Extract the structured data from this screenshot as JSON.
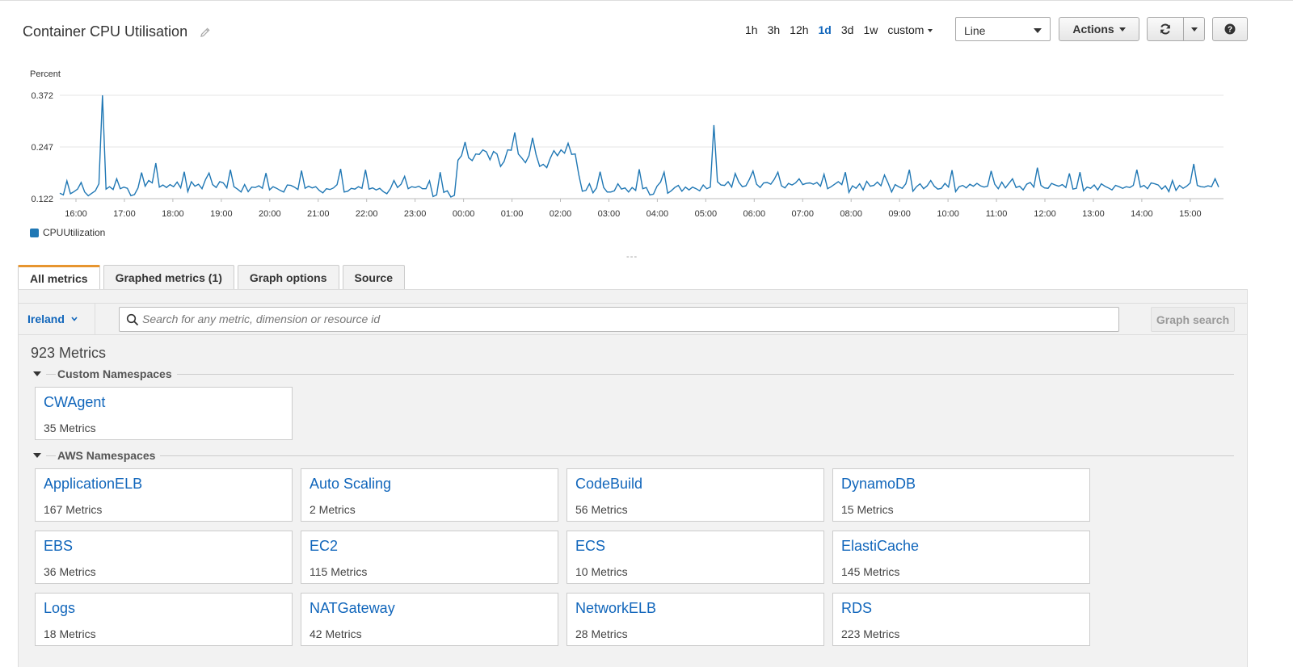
{
  "header": {
    "title": "Container CPU Utilisation",
    "time_ranges": [
      "1h",
      "3h",
      "12h",
      "1d",
      "3d",
      "1w"
    ],
    "active_range": "1d",
    "custom_label": "custom",
    "view_type": "Line",
    "actions_label": "Actions",
    "help_label": "?"
  },
  "chart": {
    "unit_label": "Percent",
    "y_ticks": [
      "0.372",
      "0.247",
      "0.122"
    ],
    "x_ticks": [
      "16:00",
      "17:00",
      "18:00",
      "19:00",
      "20:00",
      "21:00",
      "22:00",
      "23:00",
      "00:00",
      "01:00",
      "02:00",
      "03:00",
      "04:00",
      "05:00",
      "06:00",
      "07:00",
      "08:00",
      "09:00",
      "10:00",
      "11:00",
      "12:00",
      "13:00",
      "14:00",
      "15:00"
    ],
    "legend": "CPUUtilization",
    "color": "#1f77b4"
  },
  "chart_data": {
    "type": "line",
    "ylabel": "Percent",
    "ylim": [
      0.122,
      0.372
    ],
    "x_start": "15:40",
    "x_end": "15:35",
    "series": [
      {
        "name": "CPUUtilization",
        "values": [
          0.135,
          0.131,
          0.165,
          0.134,
          0.139,
          0.145,
          0.161,
          0.138,
          0.129,
          0.135,
          0.141,
          0.158,
          0.372,
          0.145,
          0.151,
          0.144,
          0.17,
          0.146,
          0.15,
          0.147,
          0.129,
          0.132,
          0.148,
          0.185,
          0.152,
          0.166,
          0.16,
          0.208,
          0.15,
          0.155,
          0.149,
          0.156,
          0.151,
          0.162,
          0.148,
          0.187,
          0.139,
          0.163,
          0.152,
          0.157,
          0.146,
          0.168,
          0.184,
          0.156,
          0.149,
          0.163,
          0.16,
          0.148,
          0.192,
          0.151,
          0.145,
          0.138,
          0.156,
          0.139,
          0.15,
          0.149,
          0.153,
          0.147,
          0.184,
          0.143,
          0.151,
          0.147,
          0.142,
          0.138,
          0.155,
          0.154,
          0.15,
          0.144,
          0.19,
          0.147,
          0.152,
          0.148,
          0.151,
          0.142,
          0.136,
          0.146,
          0.144,
          0.148,
          0.156,
          0.194,
          0.138,
          0.14,
          0.147,
          0.145,
          0.151,
          0.147,
          0.192,
          0.145,
          0.148,
          0.143,
          0.147,
          0.139,
          0.134,
          0.146,
          0.166,
          0.149,
          0.157,
          0.176,
          0.146,
          0.151,
          0.149,
          0.152,
          0.146,
          0.146,
          0.165,
          0.127,
          0.131,
          0.186,
          0.137,
          0.141,
          0.126,
          0.13,
          0.215,
          0.226,
          0.259,
          0.221,
          0.214,
          0.23,
          0.229,
          0.24,
          0.235,
          0.216,
          0.236,
          0.23,
          0.2,
          0.212,
          0.24,
          0.239,
          0.282,
          0.23,
          0.22,
          0.209,
          0.226,
          0.269,
          0.228,
          0.2,
          0.205,
          0.197,
          0.22,
          0.238,
          0.226,
          0.24,
          0.232,
          0.256,
          0.229,
          0.23,
          0.18,
          0.14,
          0.142,
          0.158,
          0.136,
          0.148,
          0.187,
          0.149,
          0.138,
          0.138,
          0.141,
          0.158,
          0.145,
          0.148,
          0.138,
          0.149,
          0.142,
          0.193,
          0.146,
          0.149,
          0.131,
          0.133,
          0.152,
          0.162,
          0.186,
          0.135,
          0.141,
          0.149,
          0.154,
          0.14,
          0.15,
          0.143,
          0.15,
          0.146,
          0.141,
          0.155,
          0.146,
          0.15,
          0.3,
          0.163,
          0.155,
          0.154,
          0.163,
          0.15,
          0.183,
          0.162,
          0.151,
          0.153,
          0.169,
          0.189,
          0.157,
          0.149,
          0.16,
          0.161,
          0.157,
          0.169,
          0.186,
          0.153,
          0.148,
          0.159,
          0.155,
          0.16,
          0.17,
          0.156,
          0.159,
          0.16,
          0.157,
          0.161,
          0.152,
          0.181,
          0.146,
          0.151,
          0.157,
          0.163,
          0.156,
          0.186,
          0.137,
          0.153,
          0.147,
          0.158,
          0.143,
          0.164,
          0.152,
          0.154,
          0.162,
          0.153,
          0.179,
          0.16,
          0.138,
          0.156,
          0.151,
          0.147,
          0.158,
          0.192,
          0.14,
          0.151,
          0.158,
          0.146,
          0.153,
          0.166,
          0.152,
          0.145,
          0.147,
          0.159,
          0.15,
          0.191,
          0.139,
          0.151,
          0.154,
          0.148,
          0.157,
          0.152,
          0.159,
          0.153,
          0.15,
          0.152,
          0.189,
          0.157,
          0.146,
          0.162,
          0.148,
          0.159,
          0.17,
          0.149,
          0.152,
          0.143,
          0.157,
          0.161,
          0.15,
          0.197,
          0.154,
          0.148,
          0.147,
          0.159,
          0.155,
          0.152,
          0.156,
          0.149,
          0.183,
          0.145,
          0.147,
          0.186,
          0.141,
          0.15,
          0.147,
          0.155,
          0.143,
          0.158,
          0.152,
          0.148,
          0.143,
          0.154,
          0.151,
          0.147,
          0.151,
          0.149,
          0.154,
          0.192,
          0.15,
          0.154,
          0.146,
          0.16,
          0.158,
          0.155,
          0.145,
          0.153,
          0.139,
          0.166,
          0.142,
          0.154,
          0.147,
          0.152,
          0.16,
          0.206,
          0.154,
          0.151,
          0.15,
          0.153,
          0.151,
          0.17,
          0.15
        ]
      }
    ]
  },
  "tabs": [
    {
      "label": "All metrics",
      "active": true
    },
    {
      "label": "Graphed metrics (1)",
      "active": false
    },
    {
      "label": "Graph options",
      "active": false
    },
    {
      "label": "Source",
      "active": false
    }
  ],
  "search": {
    "region": "Ireland",
    "placeholder": "Search for any metric, dimension or resource id",
    "value": "",
    "graph_search_label": "Graph search"
  },
  "metrics_count": "923 Metrics",
  "custom_namespaces": {
    "label": "Custom Namespaces",
    "items": [
      {
        "name": "CWAgent",
        "count": "35 Metrics"
      }
    ]
  },
  "aws_namespaces": {
    "label": "AWS Namespaces",
    "items": [
      {
        "name": "ApplicationELB",
        "count": "167 Metrics"
      },
      {
        "name": "Auto Scaling",
        "count": "2 Metrics"
      },
      {
        "name": "CodeBuild",
        "count": "56 Metrics"
      },
      {
        "name": "DynamoDB",
        "count": "15 Metrics"
      },
      {
        "name": "EBS",
        "count": "36 Metrics"
      },
      {
        "name": "EC2",
        "count": "115 Metrics"
      },
      {
        "name": "ECS",
        "count": "10 Metrics"
      },
      {
        "name": "ElastiCache",
        "count": "145 Metrics"
      },
      {
        "name": "Logs",
        "count": "18 Metrics"
      },
      {
        "name": "NATGateway",
        "count": "42 Metrics"
      },
      {
        "name": "NetworkELB",
        "count": "28 Metrics"
      },
      {
        "name": "RDS",
        "count": "223 Metrics"
      }
    ]
  }
}
